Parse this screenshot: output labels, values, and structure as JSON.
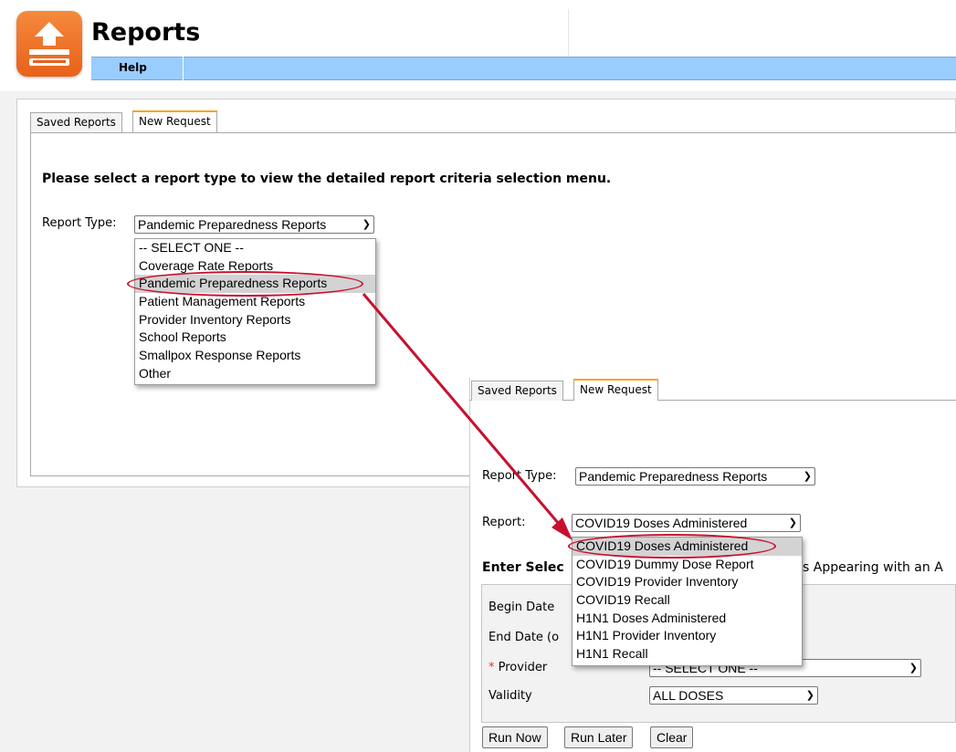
{
  "header": {
    "title": "Reports",
    "menu": {
      "help_label": "Help"
    }
  },
  "main": {
    "tabs": [
      {
        "label": "Saved Reports"
      },
      {
        "label": "New Request"
      }
    ],
    "instruction": "Please select a report type to view the detailed report criteria selection menu.",
    "report_type": {
      "label": "Report Type:",
      "selected": "Pandemic Preparedness Reports",
      "options": [
        "-- SELECT ONE --",
        "Coverage Rate Reports",
        "Pandemic Preparedness Reports",
        "Patient Management Reports",
        "Provider Inventory Reports",
        "School Reports",
        "Smallpox Response Reports",
        "Other"
      ]
    }
  },
  "inset": {
    "tabs": [
      {
        "label": "Saved Reports"
      },
      {
        "label": "New Request"
      }
    ],
    "report_type": {
      "label": "Report Type:",
      "selected": "Pandemic Preparedness Reports"
    },
    "report": {
      "label": "Report:",
      "selected": "COVID19 Doses Administered",
      "options": [
        "COVID19 Doses Administered",
        "COVID19 Dummy Dose Report",
        "COVID19 Provider Inventory",
        "COVID19 Recall",
        "H1N1 Doses Administered",
        "H1N1 Provider Inventory",
        "H1N1 Recall"
      ]
    },
    "criteria_heading_start": "Enter Selec",
    "criteria_heading_end": "s Appearing with an A",
    "fields": {
      "begin_date_label": "Begin Date",
      "end_date_label": "End Date (o",
      "required_marker": "*",
      "provider_label": "Provider",
      "provider_value": "-- SELECT ONE --",
      "validity_label": "Validity",
      "validity_value": "ALL DOSES"
    },
    "buttons": {
      "run_now": "Run Now",
      "run_later": "Run Later",
      "clear": "Clear"
    }
  },
  "colors": {
    "menu_bar": "#99ccff",
    "logo": "#ee7226",
    "active_tab_accent": "#f7a21b",
    "annotation_red": "#c8102e"
  }
}
